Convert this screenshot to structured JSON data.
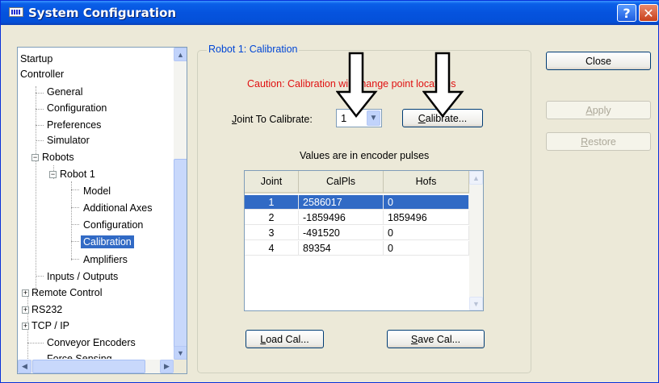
{
  "window": {
    "title": "System Configuration",
    "help_glyph": "?",
    "close_glyph": "✕"
  },
  "tree": {
    "items": [
      {
        "label": "Startup"
      },
      {
        "label": "Controller"
      },
      {
        "label": "General"
      },
      {
        "label": "Configuration"
      },
      {
        "label": "Preferences"
      },
      {
        "label": "Simulator"
      },
      {
        "label": "Robots"
      },
      {
        "label": "Robot 1"
      },
      {
        "label": "Model"
      },
      {
        "label": "Additional Axes"
      },
      {
        "label": "Configuration"
      },
      {
        "label": "Calibration"
      },
      {
        "label": "Amplifiers"
      },
      {
        "label": "Inputs / Outputs"
      },
      {
        "label": "Remote Control"
      },
      {
        "label": "RS232"
      },
      {
        "label": "TCP / IP"
      },
      {
        "label": "Conveyor Encoders"
      },
      {
        "label": "Force Sensing"
      }
    ],
    "selected": "Calibration"
  },
  "panel": {
    "group_title": "Robot 1: Calibration",
    "caution": "Caution: Calibration will change point locations",
    "joint_label_prefix": "J",
    "joint_label_rest": "oint To Calibrate:",
    "joint_value": "1",
    "calibrate_prefix": "C",
    "calibrate_rest": "alibrate...",
    "units_note": "Values are in encoder pulses",
    "table": {
      "columns": [
        "Joint",
        "CalPls",
        "Hofs"
      ],
      "rows": [
        [
          "1",
          "2586017",
          "0"
        ],
        [
          "2",
          "-1859496",
          "1859496"
        ],
        [
          "3",
          "-491520",
          "0"
        ],
        [
          "4",
          "89354",
          "0"
        ]
      ],
      "selected_row": 0
    },
    "load_prefix": "L",
    "load_rest": "oad Cal...",
    "save_prefix": "S",
    "save_rest": "ave Cal..."
  },
  "buttons": {
    "close": "Close",
    "apply_prefix": "A",
    "apply_rest": "pply",
    "restore_prefix": "R",
    "restore_rest": "estore"
  },
  "colors": {
    "title_blue": "#0553de",
    "selection": "#316ac5",
    "caution_red": "#e01010",
    "group_title": "#0046d5"
  }
}
